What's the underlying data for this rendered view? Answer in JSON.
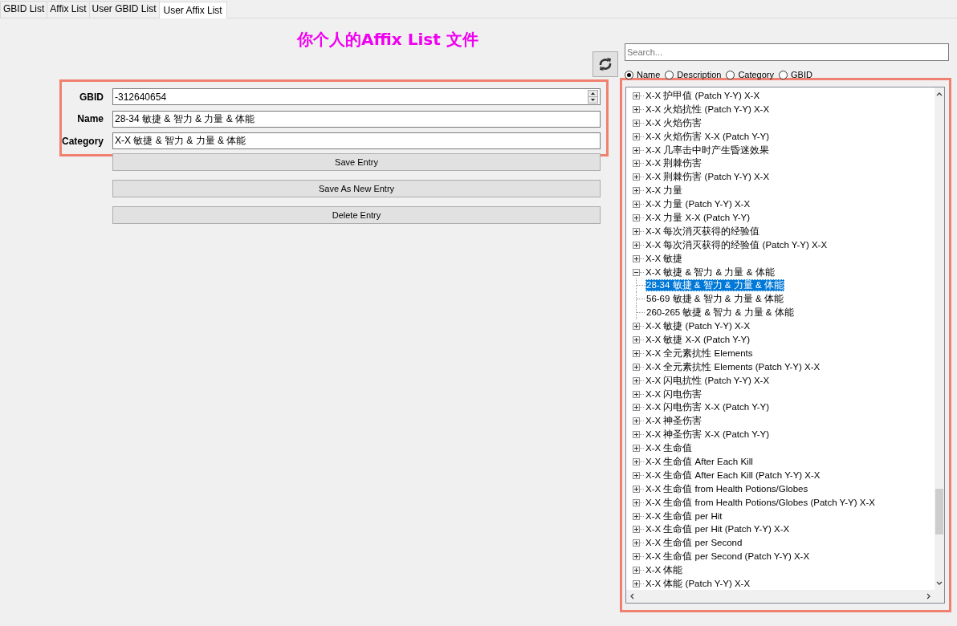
{
  "tabs": [
    {
      "label": "GBID List",
      "selected": false
    },
    {
      "label": "Affix List",
      "selected": false
    },
    {
      "label": "User GBID List",
      "selected": false
    },
    {
      "label": "User Affix List",
      "selected": true
    }
  ],
  "heading": "你个人的Affix List 文件",
  "editor": {
    "fields": [
      {
        "label": "GBID",
        "value": "-312640654",
        "kind": "spin"
      },
      {
        "label": "Name",
        "value": "28-34 敏捷 & 智力 & 力量 & 体能",
        "kind": "text"
      },
      {
        "label": "Category",
        "value": "X-X 敏捷 & 智力 & 力量 & 体能",
        "kind": "text"
      }
    ],
    "buttons": [
      "Save Entry",
      "Save As New Entry",
      "Delete Entry"
    ]
  },
  "search": {
    "placeholder": "Search...",
    "options": [
      {
        "label": "Name",
        "selected": true
      },
      {
        "label": "Description",
        "selected": false
      },
      {
        "label": "Category",
        "selected": false
      },
      {
        "label": "GBID",
        "selected": false
      }
    ]
  },
  "tree": {
    "items": [
      {
        "label": "X-X 护甲值 (Patch Y-Y) X-X",
        "expanded": false
      },
      {
        "label": "X-X 火焰抗性 (Patch Y-Y) X-X",
        "expanded": false
      },
      {
        "label": "X-X 火焰伤害",
        "expanded": false
      },
      {
        "label": "X-X 火焰伤害 X-X (Patch Y-Y)",
        "expanded": false
      },
      {
        "label": "X-X 几率击中时产生昏迷效果",
        "expanded": false
      },
      {
        "label": "X-X 荆棘伤害",
        "expanded": false
      },
      {
        "label": "X-X 荆棘伤害 (Patch Y-Y) X-X",
        "expanded": false
      },
      {
        "label": "X-X 力量",
        "expanded": false
      },
      {
        "label": "X-X 力量 (Patch Y-Y) X-X",
        "expanded": false
      },
      {
        "label": "X-X 力量 X-X (Patch Y-Y)",
        "expanded": false
      },
      {
        "label": "X-X 每次消灭获得的经验值",
        "expanded": false
      },
      {
        "label": "X-X 每次消灭获得的经验值 (Patch Y-Y) X-X",
        "expanded": false
      },
      {
        "label": "X-X 敏捷",
        "expanded": false
      },
      {
        "label": "X-X 敏捷 & 智力 & 力量 & 体能",
        "expanded": true,
        "children": [
          {
            "label": "28-34 敏捷 & 智力 & 力量 & 体能",
            "selected": true
          },
          {
            "label": "56-69 敏捷 & 智力 & 力量 & 体能",
            "selected": false
          },
          {
            "label": "260-265 敏捷 & 智力 & 力量 & 体能",
            "selected": false
          }
        ]
      },
      {
        "label": "X-X 敏捷 (Patch Y-Y) X-X",
        "expanded": false
      },
      {
        "label": "X-X 敏捷 X-X (Patch Y-Y)",
        "expanded": false
      },
      {
        "label": "X-X 全元素抗性 Elements",
        "expanded": false
      },
      {
        "label": "X-X 全元素抗性 Elements (Patch Y-Y) X-X",
        "expanded": false
      },
      {
        "label": "X-X 闪电抗性 (Patch Y-Y) X-X",
        "expanded": false
      },
      {
        "label": "X-X 闪电伤害",
        "expanded": false
      },
      {
        "label": "X-X 闪电伤害 X-X (Patch Y-Y)",
        "expanded": false
      },
      {
        "label": "X-X 神圣伤害",
        "expanded": false
      },
      {
        "label": "X-X 神圣伤害 X-X (Patch Y-Y)",
        "expanded": false
      },
      {
        "label": "X-X 生命值",
        "expanded": false
      },
      {
        "label": "X-X 生命值 After Each Kill",
        "expanded": false
      },
      {
        "label": "X-X 生命值 After Each Kill (Patch Y-Y) X-X",
        "expanded": false
      },
      {
        "label": "X-X 生命值 from Health Potions/Globes",
        "expanded": false
      },
      {
        "label": "X-X 生命值 from Health Potions/Globes (Patch Y-Y) X-X",
        "expanded": false
      },
      {
        "label": "X-X 生命值 per Hit",
        "expanded": false
      },
      {
        "label": "X-X 生命值 per Hit (Patch Y-Y) X-X",
        "expanded": false
      },
      {
        "label": "X-X 生命值 per Second",
        "expanded": false
      },
      {
        "label": "X-X 生命值 per Second (Patch Y-Y) X-X",
        "expanded": false
      },
      {
        "label": "X-X 体能",
        "expanded": false
      },
      {
        "label": "X-X 体能 (Patch Y-Y) X-X",
        "expanded": false
      }
    ]
  }
}
